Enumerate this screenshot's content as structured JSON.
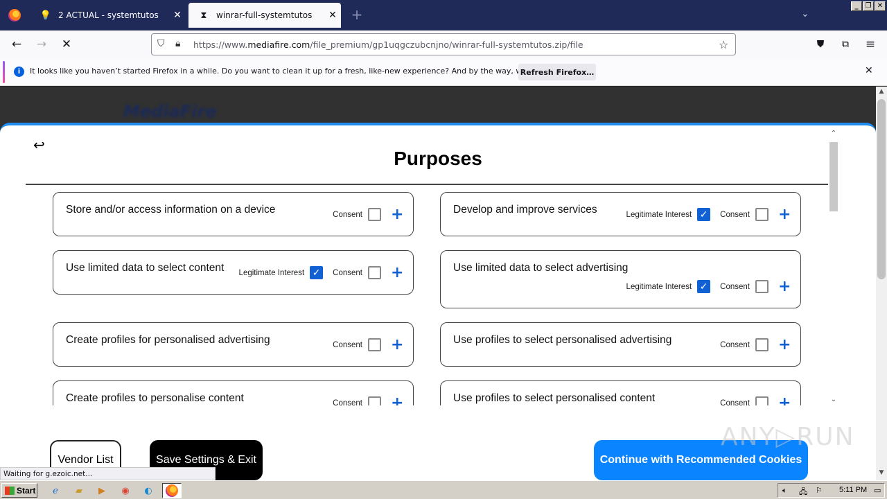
{
  "browser": {
    "tabs": [
      {
        "title": "2 ACTUAL - systemtutos",
        "active": false
      },
      {
        "title": "winrar-full-systemtutos",
        "active": true
      }
    ],
    "url_prefix": "https://www.",
    "url_domain": "mediafire.com",
    "url_path": "/file_premium/gp1uqgczubcnjno/winrar-full-systemtutos.zip/file",
    "notification": {
      "text": "It looks like you haven’t started Firefox in a while. Do you want to clean it up for a fresh, like-new experience? And by the way, welcome back!",
      "button": "Refresh Firefox…"
    },
    "status": "Waiting for g.ezoic.net…"
  },
  "site": {
    "logo": "MediaFire"
  },
  "modal": {
    "title": "Purposes",
    "labels": {
      "legitimate_interest": "Legitimate Interest",
      "consent": "Consent"
    },
    "purposes": [
      {
        "title": "Store and/or access information on a device",
        "legit": null,
        "consent": false
      },
      {
        "title": "Develop and improve services",
        "legit": true,
        "consent": false
      },
      {
        "title": "Use limited data to select content",
        "legit": true,
        "consent": false
      },
      {
        "title": "Use limited data to select advertising",
        "legit": true,
        "consent": false
      },
      {
        "title": "Create profiles for personalised advertising",
        "legit": null,
        "consent": false
      },
      {
        "title": "Use profiles to select personalised advertising",
        "legit": null,
        "consent": false
      },
      {
        "title": "Create profiles to personalise content",
        "legit": null,
        "consent": false
      },
      {
        "title": "Use profiles to select personalised content",
        "legit": null,
        "consent": false
      }
    ],
    "buttons": {
      "vendor_list": "Vendor List",
      "save_exit": "Save Settings & Exit",
      "recommended": "Continue with Recommended Cookies"
    }
  },
  "taskbar": {
    "start": "Start",
    "clock": "5:11 PM"
  },
  "watermark": "ANY▷RUN",
  "colors": {
    "accent": "#0a84ff",
    "checkbox_checked": "#1261d4",
    "tabbar": "#1f2a59"
  }
}
